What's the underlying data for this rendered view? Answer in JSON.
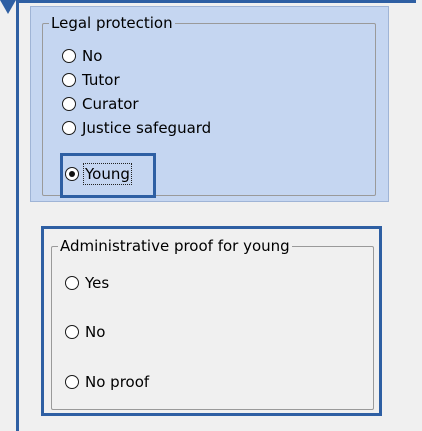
{
  "legal_protection": {
    "legend": "Legal protection",
    "options": [
      "No",
      "Tutor",
      "Curator",
      "Justice safeguard",
      "Young"
    ],
    "selected": "Young"
  },
  "admin_proof": {
    "legend": "Administrative proof for young",
    "options": [
      "Yes",
      "No",
      "No proof"
    ],
    "selected": ""
  },
  "colors": {
    "panel_background": "#c5d6f1",
    "highlight_border": "#2e5fa3",
    "window_background": "#f0f0f0"
  }
}
